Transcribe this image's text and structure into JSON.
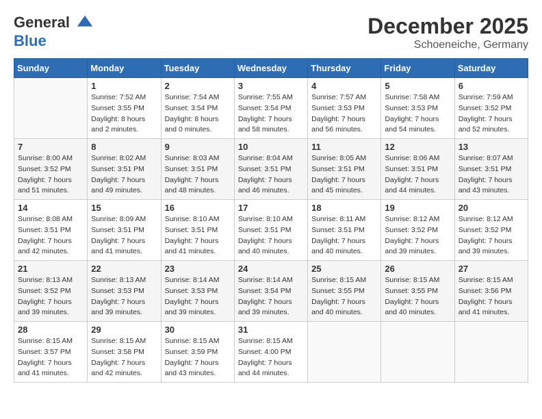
{
  "header": {
    "logo": {
      "line1": "General",
      "line2": "Blue"
    },
    "title": "December 2025",
    "location": "Schoeneiche, Germany"
  },
  "days_of_week": [
    "Sunday",
    "Monday",
    "Tuesday",
    "Wednesday",
    "Thursday",
    "Friday",
    "Saturday"
  ],
  "weeks": [
    [
      {
        "day": "",
        "info": ""
      },
      {
        "day": "1",
        "info": "Sunrise: 7:52 AM\nSunset: 3:55 PM\nDaylight: 8 hours\nand 2 minutes."
      },
      {
        "day": "2",
        "info": "Sunrise: 7:54 AM\nSunset: 3:54 PM\nDaylight: 8 hours\nand 0 minutes."
      },
      {
        "day": "3",
        "info": "Sunrise: 7:55 AM\nSunset: 3:54 PM\nDaylight: 7 hours\nand 58 minutes."
      },
      {
        "day": "4",
        "info": "Sunrise: 7:57 AM\nSunset: 3:53 PM\nDaylight: 7 hours\nand 56 minutes."
      },
      {
        "day": "5",
        "info": "Sunrise: 7:58 AM\nSunset: 3:53 PM\nDaylight: 7 hours\nand 54 minutes."
      },
      {
        "day": "6",
        "info": "Sunrise: 7:59 AM\nSunset: 3:52 PM\nDaylight: 7 hours\nand 52 minutes."
      }
    ],
    [
      {
        "day": "7",
        "info": "Sunrise: 8:00 AM\nSunset: 3:52 PM\nDaylight: 7 hours\nand 51 minutes."
      },
      {
        "day": "8",
        "info": "Sunrise: 8:02 AM\nSunset: 3:51 PM\nDaylight: 7 hours\nand 49 minutes."
      },
      {
        "day": "9",
        "info": "Sunrise: 8:03 AM\nSunset: 3:51 PM\nDaylight: 7 hours\nand 48 minutes."
      },
      {
        "day": "10",
        "info": "Sunrise: 8:04 AM\nSunset: 3:51 PM\nDaylight: 7 hours\nand 46 minutes."
      },
      {
        "day": "11",
        "info": "Sunrise: 8:05 AM\nSunset: 3:51 PM\nDaylight: 7 hours\nand 45 minutes."
      },
      {
        "day": "12",
        "info": "Sunrise: 8:06 AM\nSunset: 3:51 PM\nDaylight: 7 hours\nand 44 minutes."
      },
      {
        "day": "13",
        "info": "Sunrise: 8:07 AM\nSunset: 3:51 PM\nDaylight: 7 hours\nand 43 minutes."
      }
    ],
    [
      {
        "day": "14",
        "info": "Sunrise: 8:08 AM\nSunset: 3:51 PM\nDaylight: 7 hours\nand 42 minutes."
      },
      {
        "day": "15",
        "info": "Sunrise: 8:09 AM\nSunset: 3:51 PM\nDaylight: 7 hours\nand 41 minutes."
      },
      {
        "day": "16",
        "info": "Sunrise: 8:10 AM\nSunset: 3:51 PM\nDaylight: 7 hours\nand 41 minutes."
      },
      {
        "day": "17",
        "info": "Sunrise: 8:10 AM\nSunset: 3:51 PM\nDaylight: 7 hours\nand 40 minutes."
      },
      {
        "day": "18",
        "info": "Sunrise: 8:11 AM\nSunset: 3:51 PM\nDaylight: 7 hours\nand 40 minutes."
      },
      {
        "day": "19",
        "info": "Sunrise: 8:12 AM\nSunset: 3:52 PM\nDaylight: 7 hours\nand 39 minutes."
      },
      {
        "day": "20",
        "info": "Sunrise: 8:12 AM\nSunset: 3:52 PM\nDaylight: 7 hours\nand 39 minutes."
      }
    ],
    [
      {
        "day": "21",
        "info": "Sunrise: 8:13 AM\nSunset: 3:52 PM\nDaylight: 7 hours\nand 39 minutes."
      },
      {
        "day": "22",
        "info": "Sunrise: 8:13 AM\nSunset: 3:53 PM\nDaylight: 7 hours\nand 39 minutes."
      },
      {
        "day": "23",
        "info": "Sunrise: 8:14 AM\nSunset: 3:53 PM\nDaylight: 7 hours\nand 39 minutes."
      },
      {
        "day": "24",
        "info": "Sunrise: 8:14 AM\nSunset: 3:54 PM\nDaylight: 7 hours\nand 39 minutes."
      },
      {
        "day": "25",
        "info": "Sunrise: 8:15 AM\nSunset: 3:55 PM\nDaylight: 7 hours\nand 40 minutes."
      },
      {
        "day": "26",
        "info": "Sunrise: 8:15 AM\nSunset: 3:55 PM\nDaylight: 7 hours\nand 40 minutes."
      },
      {
        "day": "27",
        "info": "Sunrise: 8:15 AM\nSunset: 3:56 PM\nDaylight: 7 hours\nand 41 minutes."
      }
    ],
    [
      {
        "day": "28",
        "info": "Sunrise: 8:15 AM\nSunset: 3:57 PM\nDaylight: 7 hours\nand 41 minutes."
      },
      {
        "day": "29",
        "info": "Sunrise: 8:15 AM\nSunset: 3:58 PM\nDaylight: 7 hours\nand 42 minutes."
      },
      {
        "day": "30",
        "info": "Sunrise: 8:15 AM\nSunset: 3:59 PM\nDaylight: 7 hours\nand 43 minutes."
      },
      {
        "day": "31",
        "info": "Sunrise: 8:15 AM\nSunset: 4:00 PM\nDaylight: 7 hours\nand 44 minutes."
      },
      {
        "day": "",
        "info": ""
      },
      {
        "day": "",
        "info": ""
      },
      {
        "day": "",
        "info": ""
      }
    ]
  ]
}
